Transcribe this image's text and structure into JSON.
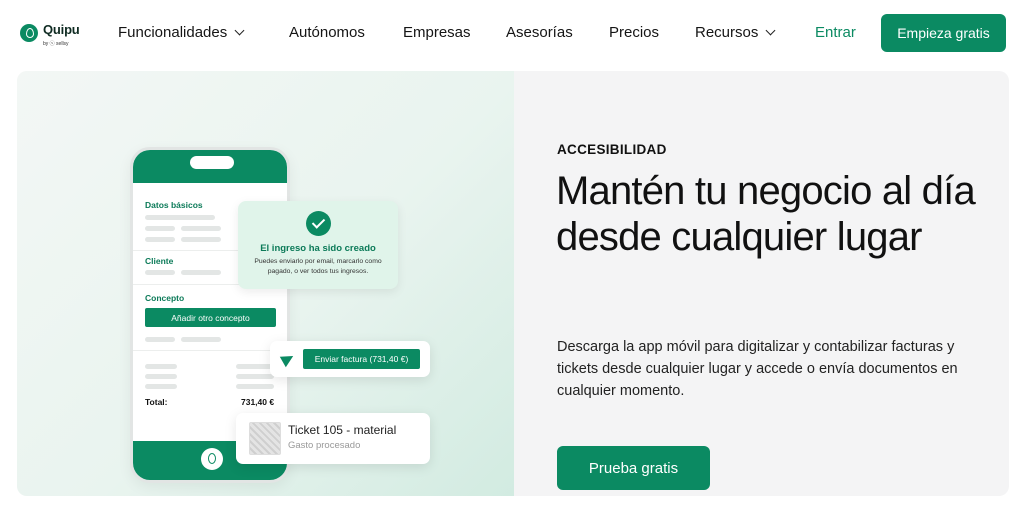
{
  "brand": {
    "name": "Quipu",
    "sub": "by ⓢ sellsy"
  },
  "nav": {
    "items": [
      {
        "label": "Funcionalidades",
        "dropdown": true
      },
      {
        "label": "Autónomos",
        "dropdown": false
      },
      {
        "label": "Empresas",
        "dropdown": false
      },
      {
        "label": "Asesorías",
        "dropdown": false
      },
      {
        "label": "Precios",
        "dropdown": false
      },
      {
        "label": "Recursos",
        "dropdown": true
      }
    ],
    "login": "Entrar",
    "cta": "Empieza gratis"
  },
  "phone": {
    "section1": "Datos básicos",
    "section2": "Cliente",
    "section3": "Concepto",
    "add_concept": "Añadir otro concepto",
    "total_label": "Total:",
    "total_value": "731,40 €"
  },
  "success_card": {
    "title": "El ingreso ha sido creado",
    "body": "Puedes enviarlo por email, marcarlo como pagado, o ver todos tus ingresos."
  },
  "send_card": {
    "button": "Enviar factura (731,40 €)"
  },
  "ticket_card": {
    "title": "Ticket 105 - material",
    "subtitle": "Gasto procesado"
  },
  "hero": {
    "eyebrow": "ACCESIBILIDAD",
    "headline": "Mantén tu negocio al día desde cualquier lugar",
    "description": "Descarga la app móvil para digitalizar y contabilizar facturas y tickets desde cualquier lugar y accede o envía documentos en cualquier momento.",
    "cta": "Prueba gratis"
  },
  "colors": {
    "brand_green": "#0b8a62",
    "success_bg": "#e0f4ea"
  }
}
